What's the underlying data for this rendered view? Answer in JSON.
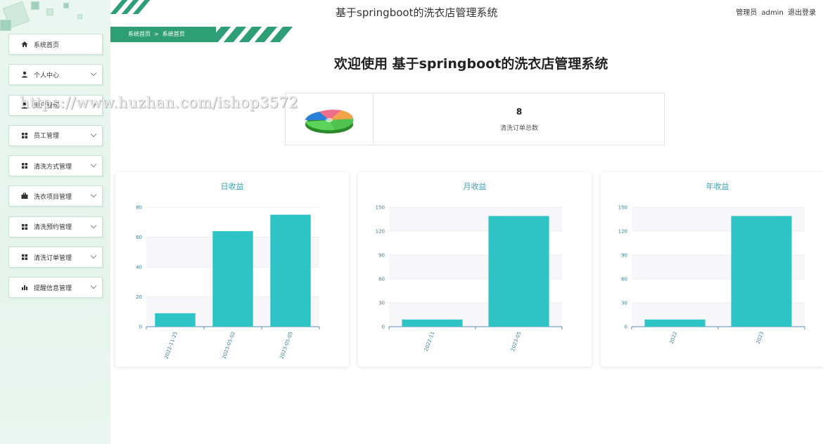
{
  "header": {
    "title": "基于springboot的洗衣店管理系统",
    "user_role": "管理员",
    "username": "admin",
    "logout_label": "退出登录"
  },
  "breadcrumb": {
    "home": "系统首页",
    "separator": ">",
    "current": "系统首页"
  },
  "welcome": "欢迎使用 基于springboot的洗衣店管理系统",
  "watermark": "https://www.huzhan.com/ishop3572",
  "sidebar": {
    "items": [
      {
        "label": "系统首页",
        "icon": "home-icon",
        "has_arrow": false
      },
      {
        "label": "个人中心",
        "icon": "user-icon",
        "has_arrow": true
      },
      {
        "label": "用户管理",
        "icon": "user-icon",
        "has_arrow": true
      },
      {
        "label": "员工管理",
        "icon": "grid-icon",
        "has_arrow": true
      },
      {
        "label": "清洗方式管理",
        "icon": "grid-icon",
        "has_arrow": true
      },
      {
        "label": "洗衣项目管理",
        "icon": "briefcase-icon",
        "has_arrow": true
      },
      {
        "label": "清洗预约管理",
        "icon": "grid-icon",
        "has_arrow": true
      },
      {
        "label": "清洗订单管理",
        "icon": "grid-icon",
        "has_arrow": true
      },
      {
        "label": "提醒信息管理",
        "icon": "bar-chart-icon",
        "has_arrow": true
      }
    ]
  },
  "stat": {
    "value": "8",
    "label": "清洗订单总数",
    "icon": "pie-chart-icon"
  },
  "colors": {
    "accent": "#2e9e76",
    "bar": "#2ec4c6",
    "title": "#3ba3b8"
  },
  "chart_data": [
    {
      "type": "bar",
      "title": "日收益",
      "categories": [
        "2022-11-25",
        "2023-05-02",
        "2023-05-05"
      ],
      "values": [
        9,
        64,
        75
      ],
      "ylim": [
        0,
        80
      ],
      "yticks": [
        0,
        20,
        40,
        60,
        80
      ],
      "xlabel": "",
      "ylabel": "",
      "grid": true
    },
    {
      "type": "bar",
      "title": "月收益",
      "categories": [
        "2022-11",
        "2023-05"
      ],
      "values": [
        9,
        139
      ],
      "ylim": [
        0,
        150
      ],
      "yticks": [
        0,
        30,
        60,
        90,
        120,
        150
      ],
      "xlabel": "",
      "ylabel": "",
      "grid": true
    },
    {
      "type": "bar",
      "title": "年收益",
      "categories": [
        "2022",
        "2023"
      ],
      "values": [
        9,
        139
      ],
      "ylim": [
        0,
        150
      ],
      "yticks": [
        0,
        30,
        60,
        90,
        120,
        150
      ],
      "xlabel": "",
      "ylabel": "",
      "grid": true
    }
  ]
}
